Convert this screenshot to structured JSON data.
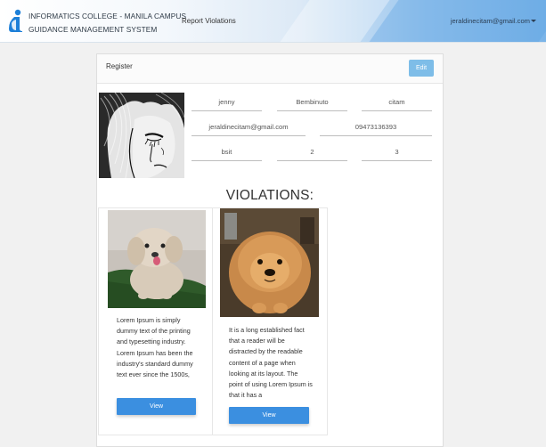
{
  "header": {
    "brand_line1": "INFORMATICS COLLEGE - MANILA CAMPUS",
    "brand_line2": "GUIDANCE MANAGEMENT SYSTEM",
    "nav_report": "Report Violations",
    "user_email": "jeraldinecitam@gmail.com"
  },
  "register": {
    "title": "Register",
    "edit_label": "Edit",
    "fields": {
      "first_name": "jenny",
      "middle_name": "Bembinuto",
      "last_name": "citam",
      "email": "jeraldinecitam@gmail.com",
      "phone": "09473136393",
      "course": "bsit",
      "year": "2",
      "section": "3"
    }
  },
  "violations": {
    "heading": "VIOLATIONS:",
    "items": [
      {
        "description": "Lorem Ipsum is simply dummy text of the printing and typesetting industry. Lorem Ipsum has been the industry's standard dummy text ever since the 1500s,",
        "button_label": "View"
      },
      {
        "description": "It is a long established fact that a reader will be distracted by the readable content of a page when looking at its layout. The point of using Lorem Ipsum is that it has a",
        "button_label": "View"
      }
    ]
  },
  "colors": {
    "edit_button": "#7ebde8",
    "view_button": "#3b8fe0",
    "logo_blue": "#1d7fd8"
  }
}
